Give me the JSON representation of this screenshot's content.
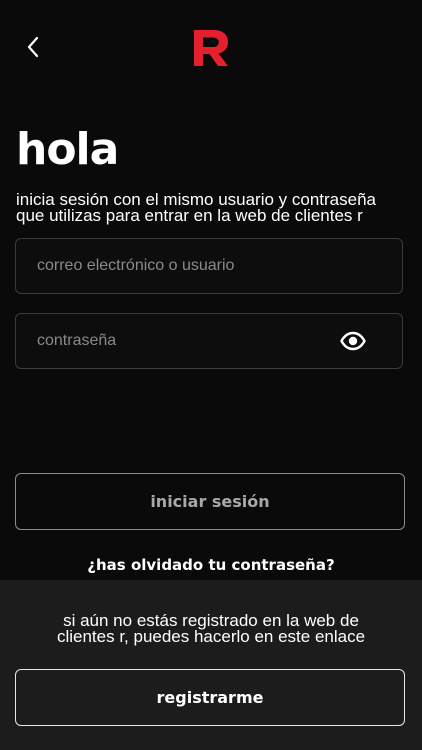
{
  "header": {
    "back_icon": "chevron-left-icon",
    "logo_icon": "brand-r-logo",
    "brand_color": "#e4202e"
  },
  "login": {
    "title": "hola",
    "intro_line1": "inicia sesión con el mismo usuario y contraseña",
    "intro_line2": "que utilizas para entrar en la web de clientes r",
    "username": {
      "value": "",
      "placeholder": "correo electrónico o usuario"
    },
    "password": {
      "value": "",
      "placeholder": "contraseña",
      "toggle_icon": "eye-icon"
    },
    "submit_label": "iniciar sesión",
    "forgot_label": "¿has olvidado tu contraseña?"
  },
  "register": {
    "text_line1": "si aún no estás registrado en la web de",
    "text_line2": "clientes r, puedes hacerlo en este enlace",
    "button_label": "registrarme"
  },
  "colors": {
    "background": "#0a0a0a",
    "panel": "#1c1c1c",
    "disabled_text": "#a8a8a8"
  }
}
